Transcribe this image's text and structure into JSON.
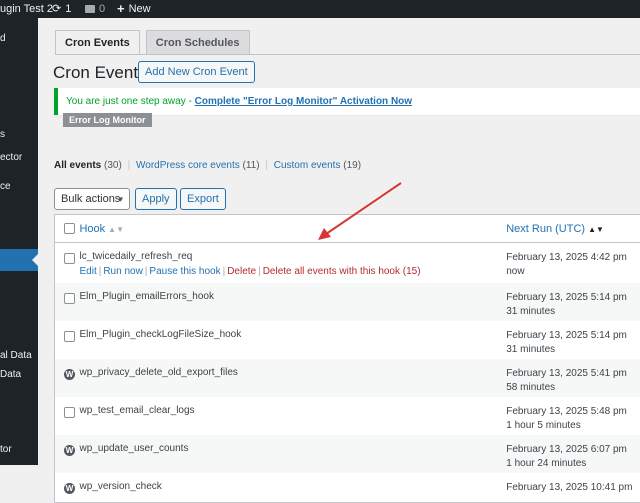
{
  "adminbar": {
    "site_title": "ugin Test 2",
    "updates_count": "1",
    "comments_count": "0",
    "new_label": "New"
  },
  "sidebar": {
    "items": [
      "d",
      "s",
      "ector",
      "ce",
      "al Data",
      "Data",
      "tor"
    ]
  },
  "tabs": [
    {
      "label": "Cron Events"
    },
    {
      "label": "Cron Schedules"
    }
  ],
  "page": {
    "title": "Cron Events",
    "add_new_label": "Add New Cron Event"
  },
  "notice": {
    "text": "You are just one step away - ",
    "link": "Complete \"Error Log Monitor\" Activation Now",
    "badge": "Error Log Monitor"
  },
  "filters": {
    "all_label": "All events",
    "all_count": "(30)",
    "core_label": "WordPress core events",
    "core_count": "(11)",
    "custom_label": "Custom events",
    "custom_count": "(19)",
    "separator": "|"
  },
  "bulk": {
    "select_label": "Bulk actions",
    "apply_label": "Apply",
    "export_label": "Export"
  },
  "table": {
    "col_hook": "Hook",
    "col_next_run": "Next Run (UTC)",
    "row_actions": {
      "edit": "Edit",
      "run_now": "Run now",
      "pause": "Pause this hook",
      "delete": "Delete",
      "delete_all": "Delete all events with this hook (15)",
      "separator": "|"
    },
    "rows": [
      {
        "hook": "lc_twicedaily_refresh_req",
        "date": "February 13, 2025 4:42 pm",
        "rel": "now",
        "icon": "checkbox"
      },
      {
        "hook": "Elm_Plugin_emailErrors_hook",
        "date": "February 13, 2025 5:14 pm",
        "rel": "31 minutes",
        "icon": "checkbox"
      },
      {
        "hook": "Elm_Plugin_checkLogFileSize_hook",
        "date": "February 13, 2025 5:14 pm",
        "rel": "31 minutes",
        "icon": "checkbox"
      },
      {
        "hook": "wp_privacy_delete_old_export_files",
        "date": "February 13, 2025 5:41 pm",
        "rel": "58 minutes",
        "icon": "wordpress"
      },
      {
        "hook": "wp_test_email_clear_logs",
        "date": "February 13, 2025 5:48 pm",
        "rel": "1 hour 5 minutes",
        "icon": "checkbox"
      },
      {
        "hook": "wp_update_user_counts",
        "date": "February 13, 2025 6:07 pm",
        "rel": "1 hour 24 minutes",
        "icon": "wordpress"
      },
      {
        "hook": "wp_version_check",
        "date": "February 13, 2025 10:41 pm",
        "rel": "",
        "icon": "wordpress"
      }
    ]
  },
  "colors": {
    "adminbar": "#1d2327",
    "link": "#2271b1",
    "danger": "#b32d2e",
    "success": "#00a32a",
    "annotation_arrow": "#d63638"
  }
}
